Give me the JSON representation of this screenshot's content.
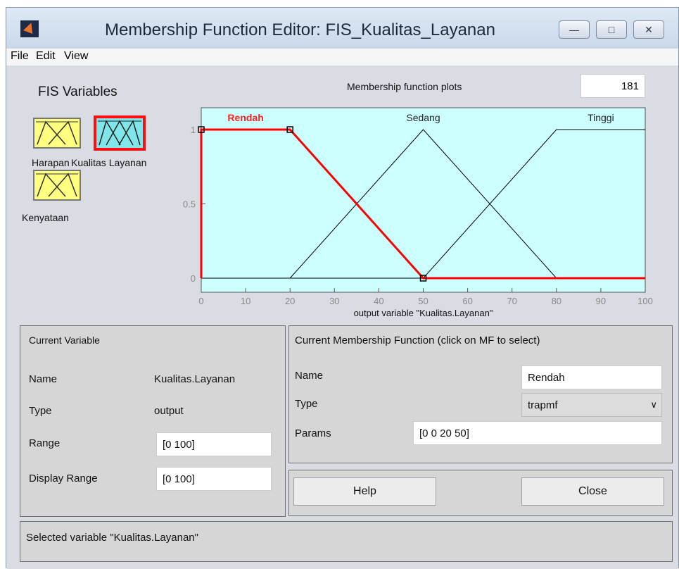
{
  "window": {
    "title": "Membership Function Editor: FIS_Kualitas_Layanan",
    "controls": {
      "minimize": "—",
      "maximize": "□",
      "close": "✕"
    }
  },
  "menu": [
    "File",
    "Edit",
    "View"
  ],
  "fis_variables": {
    "heading": "FIS Variables",
    "items": [
      {
        "label": "Harapan",
        "selected": false
      },
      {
        "label": "Kualitas Layanan",
        "selected": true
      },
      {
        "label": "Kenyataan",
        "selected": false
      }
    ]
  },
  "plot": {
    "title": "Membership function plots",
    "points_value": "181",
    "xlabel": "output variable \"Kualitas.Layanan\""
  },
  "chart_data": {
    "type": "line",
    "xlim": [
      0,
      100
    ],
    "ylim": [
      0,
      1
    ],
    "x_ticks": [
      "0",
      "10",
      "20",
      "30",
      "40",
      "50",
      "60",
      "70",
      "80",
      "90",
      "100"
    ],
    "y_ticks": [
      "0",
      "0.5",
      "1"
    ],
    "xlabel": "output variable \"Kualitas.Layanan\"",
    "background": "#ccffff",
    "series": [
      {
        "name": "Rendah",
        "color": "#ff0000",
        "selected": true,
        "x": [
          0,
          0,
          20,
          50,
          100
        ],
        "y": [
          0,
          1,
          1,
          0,
          0
        ]
      },
      {
        "name": "Sedang",
        "color": "#000000",
        "selected": false,
        "x": [
          0,
          20,
          50,
          80,
          100
        ],
        "y": [
          0,
          0,
          1,
          0,
          0
        ]
      },
      {
        "name": "Tinggi",
        "color": "#000000",
        "selected": false,
        "x": [
          0,
          50,
          80,
          100
        ],
        "y": [
          0,
          0,
          1,
          1
        ]
      }
    ]
  },
  "current_variable": {
    "heading": "Current Variable",
    "name_label": "Name",
    "name_value": "Kualitas.Layanan",
    "type_label": "Type",
    "type_value": "output",
    "range_label": "Range",
    "range_value": "[0 100]",
    "display_range_label": "Display Range",
    "display_range_value": "[0 100]"
  },
  "current_mf": {
    "heading": "Current Membership Function (click on MF to select)",
    "name_label": "Name",
    "name_value": "Rendah",
    "type_label": "Type",
    "type_value": "trapmf",
    "params_label": "Params",
    "params_value": "[0 0 20 50]"
  },
  "buttons": {
    "help": "Help",
    "close": "Close"
  },
  "status": "Selected variable \"Kualitas.Layanan\""
}
